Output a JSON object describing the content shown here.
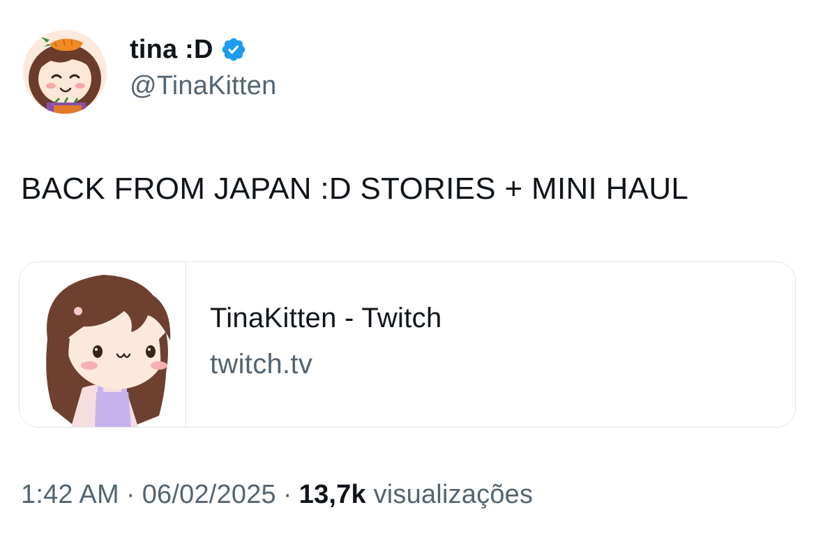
{
  "author": {
    "display_name": "tina :D",
    "handle": "@TinaKitten",
    "verified": true,
    "verified_color": "#1d9bf0",
    "avatar_icon": "cartoon-girl-carrot-hat-avatar"
  },
  "tweet": {
    "text": "BACK FROM JAPAN :D STORIES + MINI HAUL"
  },
  "link_card": {
    "title": "TinaKitten - Twitch",
    "domain": "twitch.tv",
    "thumbnail_icon": "cartoon-girl-brown-hair-thumbnail"
  },
  "meta": {
    "time": "1:42 AM",
    "separator": "·",
    "date": "06/02/2025",
    "views_count": "13,7k",
    "views_label": "visualizações"
  }
}
